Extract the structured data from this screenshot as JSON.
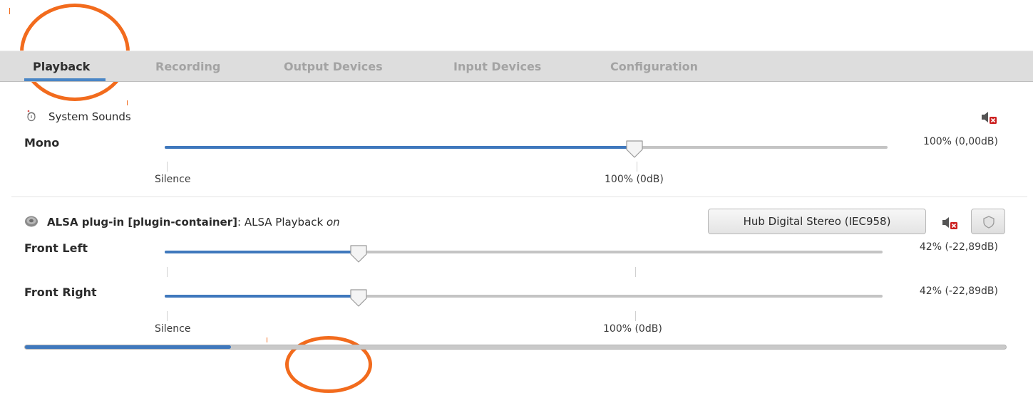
{
  "tabs": [
    {
      "label": "Playback",
      "active": true
    },
    {
      "label": "Recording",
      "active": false
    },
    {
      "label": "Output Devices",
      "active": false
    },
    {
      "label": "Input Devices",
      "active": false
    },
    {
      "label": "Configuration",
      "active": false
    }
  ],
  "system_sounds": {
    "title": "System Sounds",
    "icon": "system-sounds-icon",
    "mute_icon": "speaker-muted-icon",
    "channel": {
      "label": "Mono",
      "volume_fraction": 0.65,
      "value_text": "100% (0,00dB)"
    },
    "scale": {
      "silence": "Silence",
      "full": "100% (0dB)"
    }
  },
  "alsa": {
    "name": "ALSA plug-in [plugin-container]",
    "separator": ":",
    "stream": "ALSA Playback",
    "state": "on",
    "icon": "speaker-device-icon",
    "device_button": "Hub Digital Stereo (IEC958)",
    "mute_icon": "speaker-muted-icon",
    "lock_icon": "shield-lock-icon",
    "channels": [
      {
        "label": "Front Left",
        "volume_fraction": 0.27,
        "value_text": "42% (-22,89dB)"
      },
      {
        "label": "Front Right",
        "volume_fraction": 0.27,
        "value_text": "42% (-22,89dB)"
      }
    ],
    "scale": {
      "silence": "Silence",
      "full": "100% (0dB)"
    }
  },
  "bottom_scroll": {
    "fraction": 0.21
  },
  "colors": {
    "accent": "#3f78bd",
    "annotation": "#f26b1d",
    "mute_red": "#cc1f1f"
  }
}
